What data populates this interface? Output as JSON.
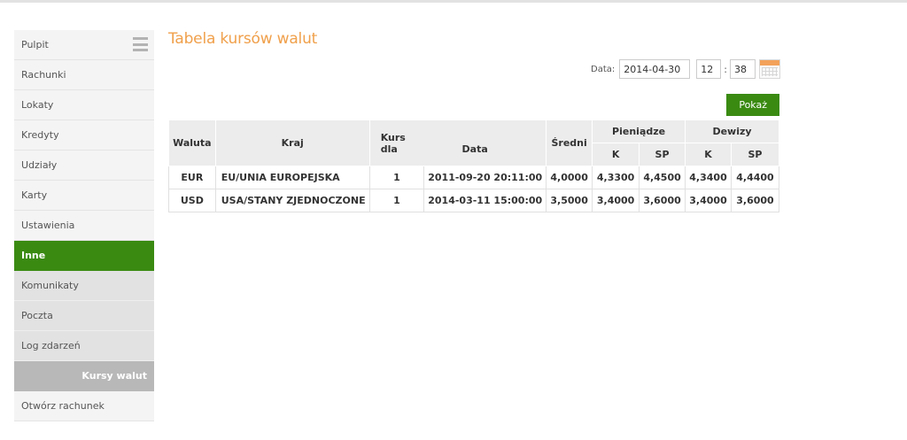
{
  "sidebar": {
    "items": [
      {
        "label": "Pulpit"
      },
      {
        "label": "Rachunki"
      },
      {
        "label": "Lokaty"
      },
      {
        "label": "Kredyty"
      },
      {
        "label": "Udziały"
      },
      {
        "label": "Karty"
      },
      {
        "label": "Ustawienia"
      },
      {
        "label": "Inne"
      },
      {
        "label": "Komunikaty"
      },
      {
        "label": "Poczta"
      },
      {
        "label": "Log zdarzeń"
      },
      {
        "label": "Kursy walut"
      },
      {
        "label": "Otwórz rachunek"
      }
    ]
  },
  "page": {
    "title": "Tabela kursów walut"
  },
  "filter": {
    "date_label": "Data:",
    "date_value": "2014-04-30",
    "hour_value": "12",
    "colon": ":",
    "minute_value": "38",
    "show_label": "Pokaż"
  },
  "table": {
    "headers": {
      "currency": "Waluta",
      "country": "Kraj",
      "rate_for": "Kurs dla",
      "date": "Data",
      "average": "Średni",
      "cash": "Pieniądze",
      "foreign": "Dewizy",
      "buy": "K",
      "sell": "SP"
    },
    "rows": [
      {
        "currency": "EUR",
        "country": "EU/UNIA EUROPEJSKA",
        "rate_for": "1",
        "date": "2011-09-20 20:11:00",
        "average": "4,0000",
        "cash_buy": "4,3300",
        "cash_sell": "4,4500",
        "foreign_buy": "4,3400",
        "foreign_sell": "4,4400"
      },
      {
        "currency": "USD",
        "country": "USA/STANY ZJEDNOCZONE",
        "rate_for": "1",
        "date": "2014-03-11 15:00:00",
        "average": "3,5000",
        "cash_buy": "3,4000",
        "cash_sell": "3,6000",
        "foreign_buy": "3,4000",
        "foreign_sell": "3,6000"
      }
    ]
  },
  "colors": {
    "accent_green": "#3a8a12",
    "title_orange": "#f0a04b",
    "submenu_active": "#b8b8b8"
  }
}
